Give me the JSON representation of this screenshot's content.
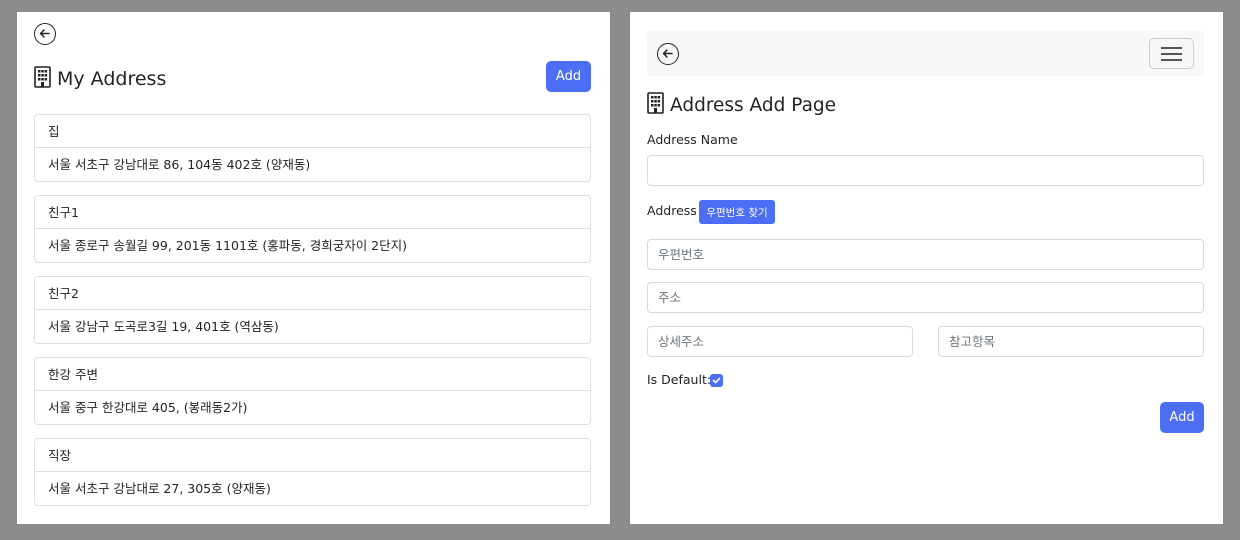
{
  "list_page": {
    "title": "My Address",
    "add_label": "Add",
    "addresses": [
      {
        "name": "집",
        "address": "서울 서초구 강남대로 86, 104동 402호 (양재동)"
      },
      {
        "name": "친구1",
        "address": "서울 종로구 송월길 99, 201동 1101호 (홍파동, 경희궁자이 2단지)"
      },
      {
        "name": "친구2",
        "address": "서울 강남구 도곡로3길 19, 401호 (역삼동)"
      },
      {
        "name": "한강 주변",
        "address": "서울 중구 한강대로 405, (봉래동2가)"
      },
      {
        "name": "직장",
        "address": "서울 서초구 강남대로 27, 305호 (양재동)"
      }
    ]
  },
  "add_page": {
    "title": "Address Add Page",
    "address_name_label": "Address Name",
    "address_name_value": "",
    "address_label": "Address",
    "postcode_button_label": "우편번호 찾기",
    "postcode_placeholder": "우편번호",
    "address_placeholder": "주소",
    "detail_placeholder": "상세주소",
    "extra_placeholder": "참고항목",
    "is_default_label": "Is Default:",
    "is_default": true,
    "add_label": "Add"
  },
  "colors": {
    "accent": "#4c6ef5",
    "backdrop": "#8c8c8c"
  },
  "icons": {
    "back": "arrow-left-circle-icon",
    "title": "building-icon",
    "menu": "hamburger-icon"
  }
}
